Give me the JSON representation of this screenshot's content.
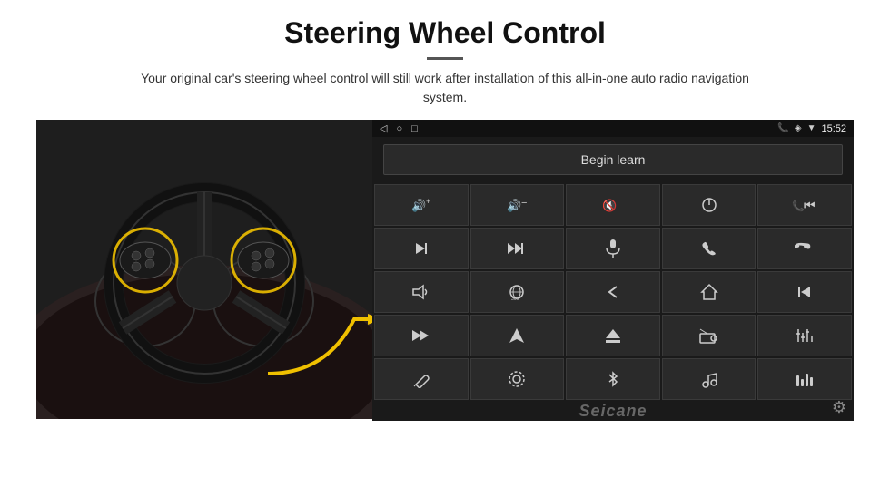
{
  "header": {
    "title": "Steering Wheel Control",
    "divider": true,
    "subtitle": "Your original car's steering wheel control will still work after installation of this all-in-one auto radio navigation system."
  },
  "statusBar": {
    "leftIcons": [
      "◁",
      "○",
      "□"
    ],
    "rightIcons": [
      "📱",
      "📶"
    ],
    "time": "15:52"
  },
  "beginLearnButton": {
    "label": "Begin learn"
  },
  "controlsGrid": [
    {
      "icon": "🔊+",
      "label": "vol-up"
    },
    {
      "icon": "🔊−",
      "label": "vol-down"
    },
    {
      "icon": "🔇",
      "label": "mute"
    },
    {
      "icon": "⏻",
      "label": "power"
    },
    {
      "icon": "⏮",
      "label": "prev-track-call"
    },
    {
      "icon": "⏭",
      "label": "next"
    },
    {
      "icon": "✂⏭",
      "label": "fast-forward"
    },
    {
      "icon": "🎤",
      "label": "mic"
    },
    {
      "icon": "📞",
      "label": "call"
    },
    {
      "icon": "📞✗",
      "label": "end-call"
    },
    {
      "icon": "📣",
      "label": "horn"
    },
    {
      "icon": "360°",
      "label": "360-cam"
    },
    {
      "icon": "↩",
      "label": "back"
    },
    {
      "icon": "🏠",
      "label": "home"
    },
    {
      "icon": "⏮⏮",
      "label": "rewind"
    },
    {
      "icon": "⏭⏭",
      "label": "skip"
    },
    {
      "icon": "➤",
      "label": "nav"
    },
    {
      "icon": "⏏",
      "label": "eject"
    },
    {
      "icon": "📻",
      "label": "radio"
    },
    {
      "icon": "⚙",
      "label": "eq"
    },
    {
      "icon": "🎙",
      "label": "mic2"
    },
    {
      "icon": "⚙",
      "label": "settings"
    },
    {
      "icon": "✱",
      "label": "bluetooth"
    },
    {
      "icon": "🎵",
      "label": "music"
    },
    {
      "icon": "📊",
      "label": "equalizer"
    }
  ],
  "seicane": {
    "brand": "Seicane"
  }
}
